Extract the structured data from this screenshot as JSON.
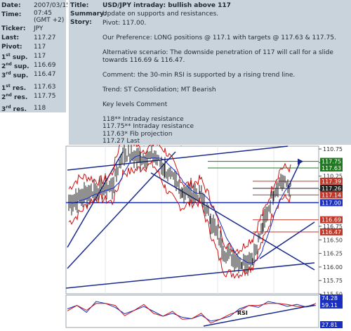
{
  "left_table": [
    {
      "label": "Date:",
      "value": "2007/03/15"
    },
    {
      "label": "Time:",
      "value": "07:45\n(GMT +2)"
    },
    {
      "label": "Ticker:",
      "value": "JPY"
    },
    {
      "label": "Last:",
      "value": "117.27"
    },
    {
      "label": "Pivot:",
      "value": "117"
    },
    {
      "label": "1st sup.",
      "value": "117",
      "sup": "st"
    },
    {
      "label": "2nd sup.",
      "value": "116.69",
      "sup": "nd"
    },
    {
      "label": "3rd sup.",
      "value": "116.47",
      "sup": "rd"
    },
    {
      "label": "1st res.",
      "value": "117.63",
      "sup": "st"
    },
    {
      "label": "2nd res.",
      "value": "117.75",
      "sup": "nd"
    },
    {
      "label": "3rd res.",
      "value": "118",
      "sup": "rd"
    }
  ],
  "article": {
    "title_label": "Title:",
    "title": "USD/JPY intraday: bullish above 117",
    "summary_label": "Summary:",
    "summary": "Update on supports and resistances.",
    "story_label": "Story:",
    "story_paragraphs": [
      "Pivot: 117.00.",
      "Our Preference: LONG positions @ 117.1 with targets @ 117.63 & 117.75.",
      "Alternative scenario: The downside penetration of 117 will call for a slide towards 116.69 & 116.47.",
      "Comment: the 30-min RSI is supported by a rising trend line.",
      "Trend: ST Consolidation; MT Bearish",
      "Key levels Comment"
    ],
    "key_levels": [
      "118** Intraday resistance",
      "117.75** Intraday resistance",
      "117.63* Fib projection",
      "117.27 Last",
      "117*** Intraday pivot point",
      "116.69** Fib retracement (50%)",
      "116.47** Fib retracement (61.8%)"
    ]
  },
  "chart_data": [
    {
      "type": "line",
      "title": "",
      "ylim": [
        115.5,
        110.75
      ],
      "y_ticks": [
        "110.75",
        "110.50",
        "110.25",
        "110.00",
        "116.75",
        "116.50",
        "116.25",
        "116.00",
        "115.75",
        "115.50"
      ],
      "axis_ticks": [
        {
          "label": "110.75",
          "y": 0
        },
        {
          "label": "110.50",
          "y": 1
        },
        {
          "label": "110.25",
          "y": 2
        },
        {
          "label": "110.00",
          "y": 3
        },
        {
          "label": "116.75",
          "y": 5.7
        },
        {
          "label": "116.50",
          "y": 6.7
        },
        {
          "label": "116.25",
          "y": 7.7
        },
        {
          "label": "116.00",
          "y": 8.7
        },
        {
          "label": "115.75",
          "y": 9.7
        },
        {
          "label": "115.50",
          "y": 10.7
        }
      ],
      "level_labels": [
        {
          "label": "117.75",
          "color": "#1f7a1f",
          "level": 117.75
        },
        {
          "label": "117.63",
          "color": "#1f7a1f",
          "level": 117.63
        },
        {
          "label": "117.39",
          "color": "#c0392b",
          "level": 117.39
        },
        {
          "label": "117.26",
          "color": "#222222",
          "level": 117.26
        },
        {
          "label": "117.14",
          "color": "#c0392b",
          "level": 117.14
        },
        {
          "label": "117.00",
          "color": "#1a2fbf",
          "level": 117.0
        },
        {
          "label": "116.69",
          "color": "#c0392b",
          "level": 116.69
        },
        {
          "label": "116.47",
          "color": "#c0392b",
          "level": 116.47
        }
      ]
    },
    {
      "type": "line",
      "title": "RSI",
      "series": [
        {
          "name": "RSI",
          "values": [
            55,
            62,
            48,
            70,
            66,
            58,
            45,
            52,
            60,
            50,
            40,
            46,
            38,
            35,
            42,
            30,
            34,
            40,
            55,
            62,
            58,
            70,
            66,
            60,
            64,
            59,
            62
          ]
        }
      ],
      "level_labels": [
        {
          "label": "74.28",
          "color": "#1a2fbf"
        },
        {
          "label": "59.11",
          "color": "#1a2fbf"
        },
        {
          "label": "27.81",
          "color": "#1a2fbf"
        }
      ]
    }
  ],
  "colors": {
    "panel": "#c9d3dc",
    "price": "#222222",
    "bands": "#cc1111",
    "ma": "#1a2fbf",
    "support": "#1f7a1f"
  }
}
